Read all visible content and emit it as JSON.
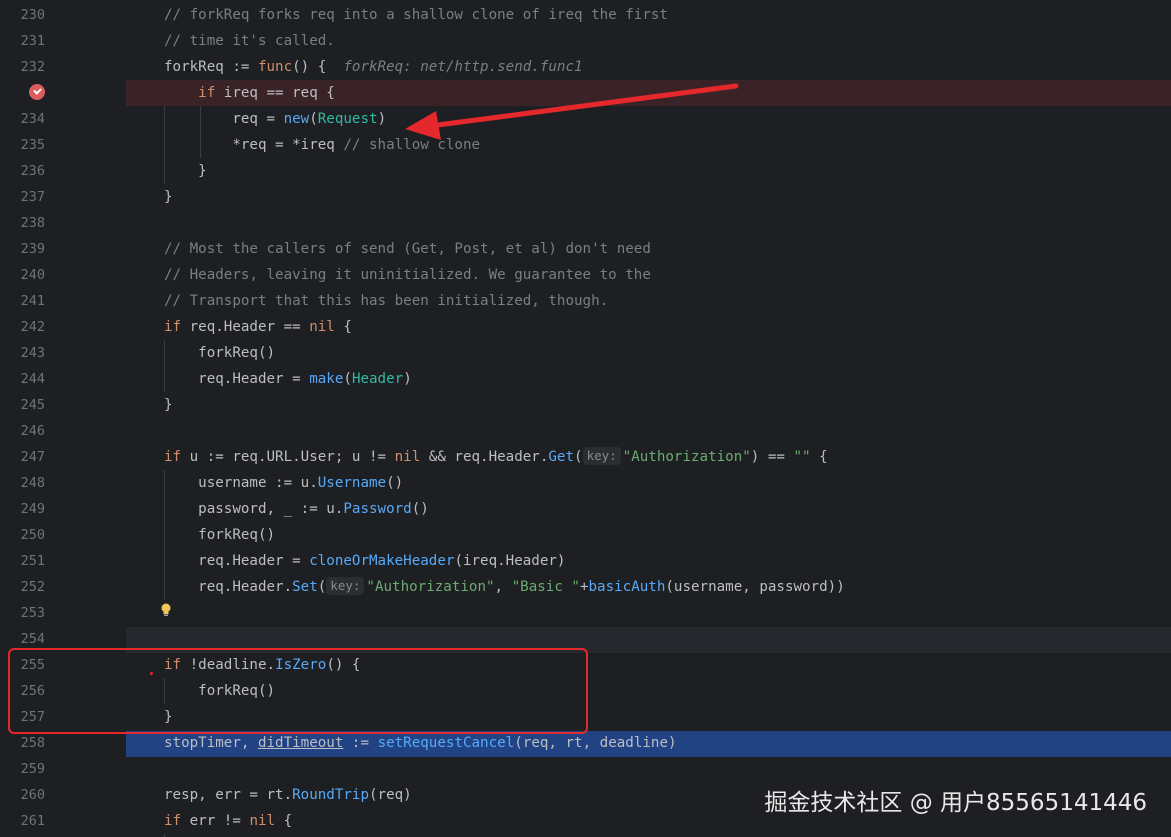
{
  "editor": {
    "lines": [
      {
        "num": "230",
        "code": [
          {
            "t": "// forkReq forks req into a shallow clone of ireq the first",
            "c": "cm"
          }
        ]
      },
      {
        "num": "231",
        "code": [
          {
            "t": "// time it's called.",
            "c": "cm"
          }
        ]
      },
      {
        "num": "232",
        "code": [
          {
            "t": "forkReq",
            "c": ""
          },
          {
            "t": " := ",
            "c": ""
          },
          {
            "t": "func",
            "c": "kw"
          },
          {
            "t": "() {  ",
            "c": ""
          },
          {
            "t": "forkReq: net/http.send.func1",
            "c": "it"
          }
        ]
      },
      {
        "num": "",
        "code": [
          {
            "t": "    ",
            "c": ""
          },
          {
            "t": "if",
            "c": "kw"
          },
          {
            "t": " ireq == req {",
            "c": ""
          }
        ]
      },
      {
        "num": "234",
        "code": [
          {
            "t": "        req = ",
            "c": ""
          },
          {
            "t": "new",
            "c": "fn"
          },
          {
            "t": "(",
            "c": ""
          },
          {
            "t": "Request",
            "c": "ty"
          },
          {
            "t": ")",
            "c": ""
          }
        ]
      },
      {
        "num": "235",
        "code": [
          {
            "t": "        *req = *ireq ",
            "c": ""
          },
          {
            "t": "// shallow clone",
            "c": "cm"
          }
        ]
      },
      {
        "num": "236",
        "code": [
          {
            "t": "    }",
            "c": ""
          }
        ]
      },
      {
        "num": "237",
        "code": [
          {
            "t": "}",
            "c": ""
          }
        ]
      },
      {
        "num": "238",
        "code": []
      },
      {
        "num": "239",
        "code": [
          {
            "t": "// Most the callers of send (Get, Post, et al) don't need",
            "c": "cm"
          }
        ]
      },
      {
        "num": "240",
        "code": [
          {
            "t": "// Headers, leaving it uninitialized. We guarantee to the",
            "c": "cm"
          }
        ]
      },
      {
        "num": "241",
        "code": [
          {
            "t": "// Transport that this has been initialized, though.",
            "c": "cm"
          }
        ]
      },
      {
        "num": "242",
        "code": [
          {
            "t": "if",
            "c": "kw"
          },
          {
            "t": " req.Header == ",
            "c": ""
          },
          {
            "t": "nil",
            "c": "kw"
          },
          {
            "t": " {",
            "c": ""
          }
        ]
      },
      {
        "num": "243",
        "code": [
          {
            "t": "    forkReq()",
            "c": ""
          }
        ]
      },
      {
        "num": "244",
        "code": [
          {
            "t": "    req.Header = ",
            "c": ""
          },
          {
            "t": "make",
            "c": "fn"
          },
          {
            "t": "(",
            "c": ""
          },
          {
            "t": "Header",
            "c": "ty"
          },
          {
            "t": ")",
            "c": ""
          }
        ]
      },
      {
        "num": "245",
        "code": [
          {
            "t": "}",
            "c": ""
          }
        ]
      },
      {
        "num": "246",
        "code": []
      },
      {
        "num": "247",
        "code": [
          {
            "t": "if",
            "c": "kw"
          },
          {
            "t": " u := req.URL.User; u != ",
            "c": ""
          },
          {
            "t": "nil",
            "c": "kw"
          },
          {
            "t": " && req.Header.",
            "c": ""
          },
          {
            "t": "Get",
            "c": "fn2"
          },
          {
            "t": "(",
            "c": ""
          },
          {
            "t": "key:",
            "c": "hint"
          },
          {
            "t": "\"Authorization\"",
            "c": "str"
          },
          {
            "t": ") == ",
            "c": ""
          },
          {
            "t": "\"\"",
            "c": "str"
          },
          {
            "t": " {",
            "c": ""
          }
        ]
      },
      {
        "num": "248",
        "code": [
          {
            "t": "    username := u.",
            "c": ""
          },
          {
            "t": "Username",
            "c": "fn2"
          },
          {
            "t": "()",
            "c": ""
          }
        ]
      },
      {
        "num": "249",
        "code": [
          {
            "t": "    password, _ := u.",
            "c": ""
          },
          {
            "t": "Password",
            "c": "fn2"
          },
          {
            "t": "()",
            "c": ""
          }
        ]
      },
      {
        "num": "250",
        "code": [
          {
            "t": "    forkReq()",
            "c": ""
          }
        ]
      },
      {
        "num": "251",
        "code": [
          {
            "t": "    req.Header = ",
            "c": ""
          },
          {
            "t": "cloneOrMakeHeader",
            "c": "fn2"
          },
          {
            "t": "(ireq.Header)",
            "c": ""
          }
        ]
      },
      {
        "num": "252",
        "code": [
          {
            "t": "    req.Header.",
            "c": ""
          },
          {
            "t": "Set",
            "c": "fn2"
          },
          {
            "t": "(",
            "c": ""
          },
          {
            "t": "key:",
            "c": "hint"
          },
          {
            "t": "\"Authorization\"",
            "c": "str"
          },
          {
            "t": ", ",
            "c": ""
          },
          {
            "t": "\"Basic \"",
            "c": "str"
          },
          {
            "t": "+",
            "c": ""
          },
          {
            "t": "basicAuth",
            "c": "fn2"
          },
          {
            "t": "(username, password))",
            "c": ""
          }
        ]
      },
      {
        "num": "253",
        "code": []
      },
      {
        "num": "254",
        "code": []
      },
      {
        "num": "255",
        "code": [
          {
            "t": "if",
            "c": "kw"
          },
          {
            "t": " !deadline.",
            "c": ""
          },
          {
            "t": "IsZero",
            "c": "fn2"
          },
          {
            "t": "() {",
            "c": ""
          }
        ]
      },
      {
        "num": "256",
        "code": [
          {
            "t": "    forkReq()",
            "c": ""
          }
        ]
      },
      {
        "num": "257",
        "code": [
          {
            "t": "}",
            "c": ""
          }
        ]
      },
      {
        "num": "258",
        "code": [
          {
            "t": "stopTimer, ",
            "c": ""
          },
          {
            "t": "didTimeout",
            "c": "ul"
          },
          {
            "t": " := ",
            "c": ""
          },
          {
            "t": "setRequestCancel",
            "c": "fn2"
          },
          {
            "t": "(req, rt, deadline)",
            "c": ""
          }
        ]
      },
      {
        "num": "259",
        "code": []
      },
      {
        "num": "260",
        "code": [
          {
            "t": "resp, err = rt.",
            "c": ""
          },
          {
            "t": "RoundTrip",
            "c": "fn2"
          },
          {
            "t": "(req)",
            "c": ""
          }
        ]
      },
      {
        "num": "261",
        "code": [
          {
            "t": "if",
            "c": "kw"
          },
          {
            "t": " err != ",
            "c": ""
          },
          {
            "t": "nil",
            "c": "kw"
          },
          {
            "t": " {",
            "c": ""
          }
        ]
      }
    ]
  },
  "watermark": "掘金技术社区 @ 用户85565141446",
  "colors": {
    "background": "#1e1f22",
    "keyword": "#cf8e6d",
    "function": "#56a8f5",
    "comment": "#7a7e85",
    "string": "#6aab73",
    "type": "#2fbaa3",
    "breakpoint_line": "#3a2326",
    "selected_line": "#214283",
    "annotation_red": "#e5282c"
  },
  "icons": {
    "breakpoint": "breakpoint-icon",
    "intention": "lightbulb-icon",
    "arrow": "red-arrow-annotation"
  }
}
